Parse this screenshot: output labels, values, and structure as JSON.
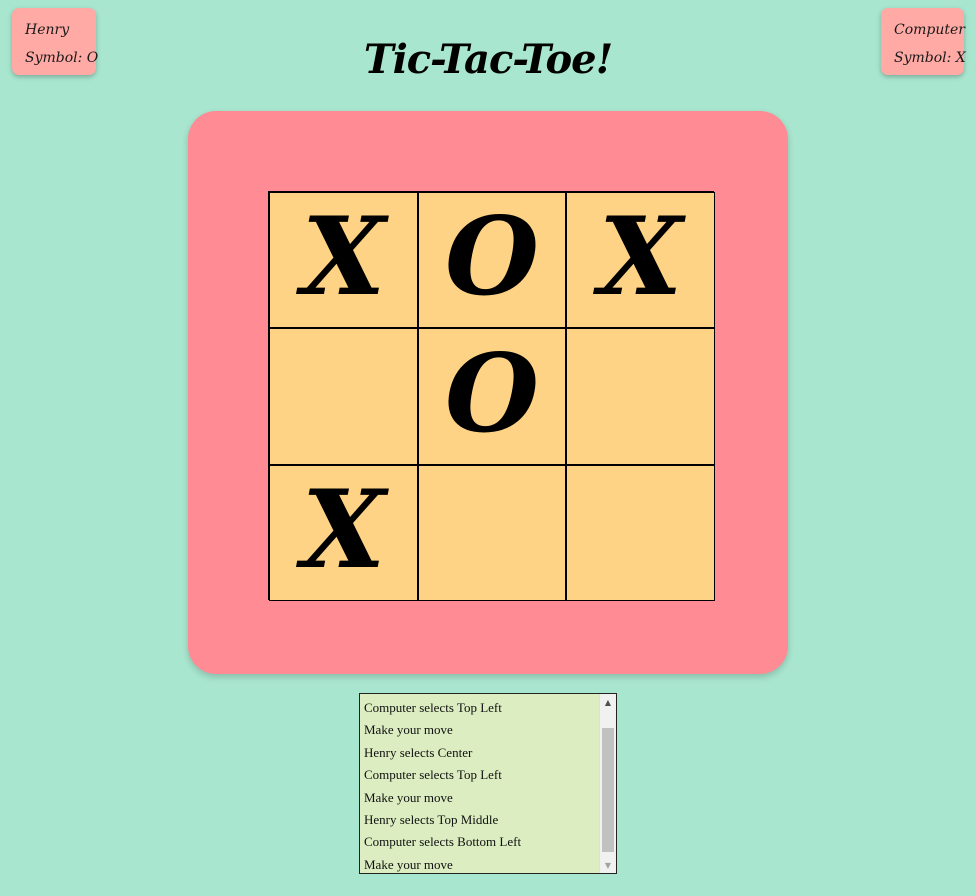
{
  "players": {
    "left": {
      "name": "Henry",
      "symbol": "Symbol: O"
    },
    "right": {
      "name": "Computer",
      "symbol": "Symbol: X"
    }
  },
  "title": "Tic-Tac-Toe!",
  "board": {
    "cells": [
      "X",
      "O",
      "X",
      "",
      "O",
      "",
      "X",
      "",
      ""
    ]
  },
  "log": {
    "items": [
      "Computer selects Top Left",
      "Make your move",
      "Henry selects Center",
      "Computer selects Top Left",
      "Make your move",
      "Henry selects Top Middle",
      "Computer selects Bottom Left",
      "Make your move"
    ]
  },
  "colors": {
    "background": "#a8e6cf",
    "player_card": "#ffaaa5",
    "board_frame": "#ff8b94",
    "cell": "#ffd385",
    "log_background": "#dcedc1"
  },
  "icons": {
    "scroll_up": "scroll-up-arrow-icon",
    "scroll_down": "scroll-down-arrow-icon"
  }
}
